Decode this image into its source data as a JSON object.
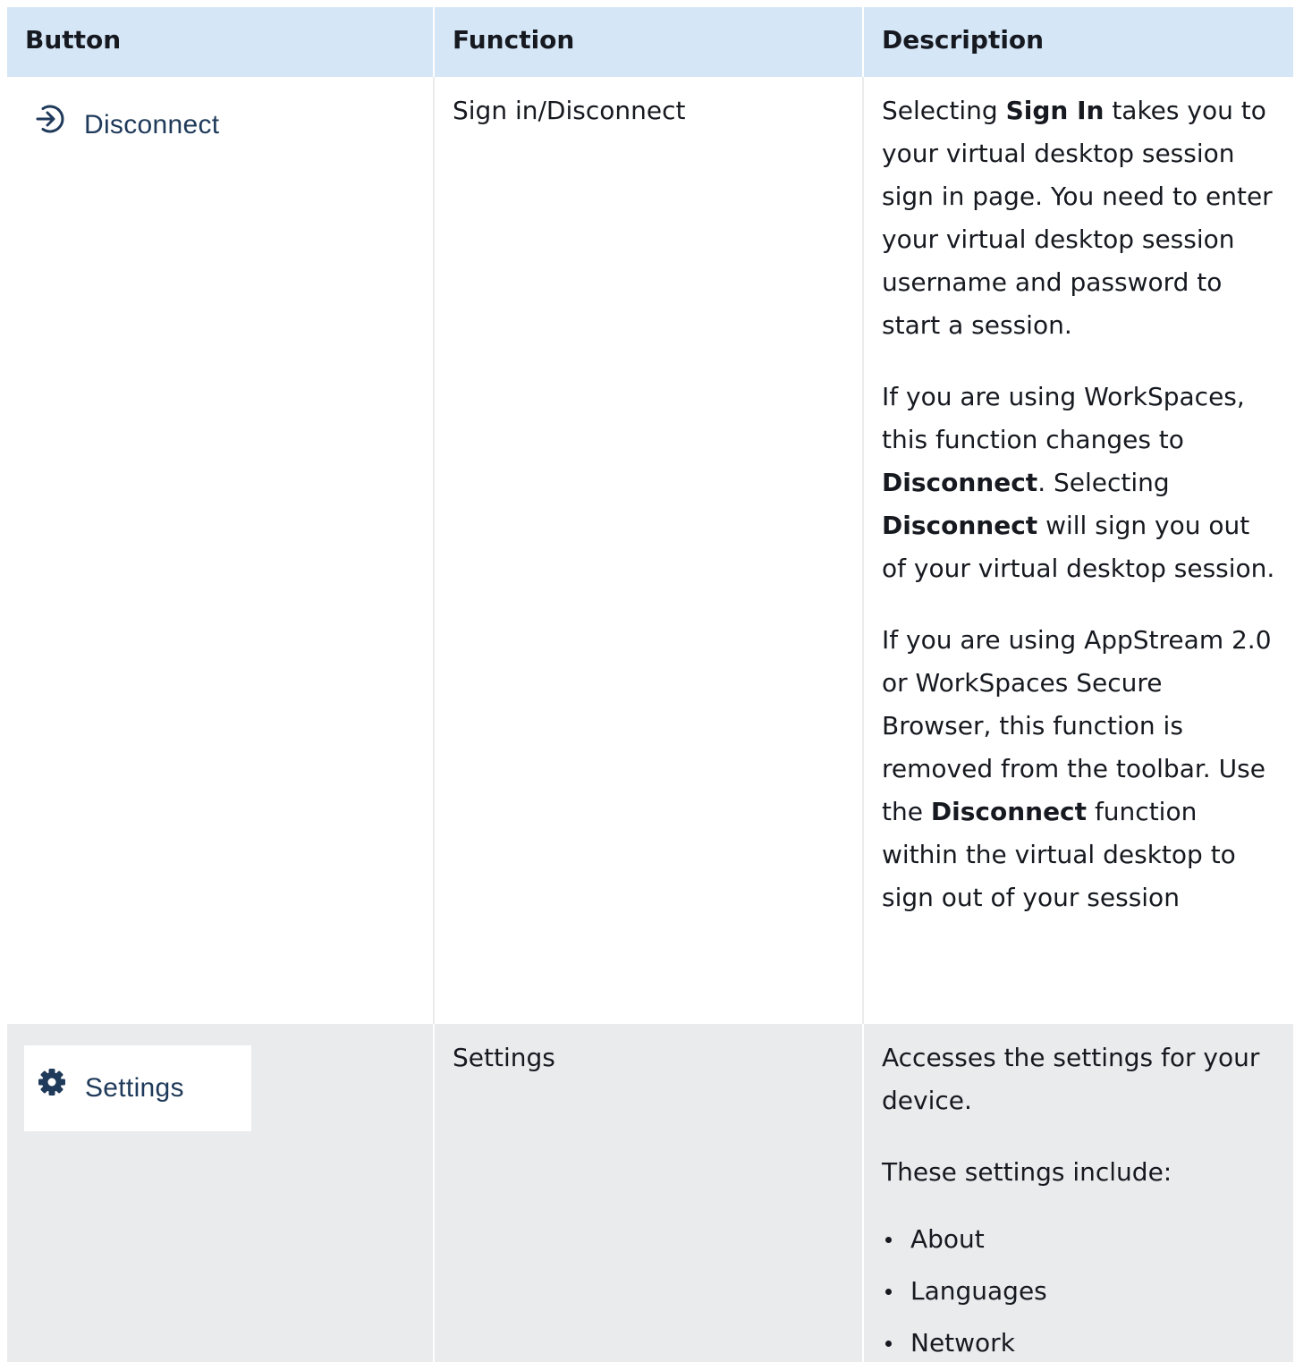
{
  "table": {
    "headers": [
      "Button",
      "Function",
      "Description"
    ],
    "rows": [
      {
        "button": {
          "label": "Disconnect",
          "icon": "sign-in-arrow-icon"
        },
        "function": "Sign in/Disconnect",
        "description": {
          "p1": {
            "a": "Selecting ",
            "b": "Sign In",
            "c": " takes you to your virtual desktop session sign in page. You need to enter your virtual desktop session username and password to start a session."
          },
          "p2": {
            "a": "If you are using WorkSpaces, this function changes to ",
            "b": "Disconnect",
            "c": ". Selecting ",
            "d": "Disconnect",
            "e": " will sign you out of your virtual desktop session."
          },
          "p3": {
            "a": "If you are using AppStream 2.0 or WorkSpaces Secure Browser, this function is removed from the toolbar. Use the ",
            "b": "Disconnect",
            "c": " function within the virtual desktop to sign out of your session"
          }
        }
      },
      {
        "button": {
          "label": "Settings",
          "icon": "gear-icon"
        },
        "function": "Settings",
        "description": {
          "p1": "Accesses the settings for your device.",
          "p2": "These settings include:",
          "items": [
            "About",
            "Languages",
            "Network"
          ]
        }
      }
    ]
  },
  "colors": {
    "header_bg": "#d5e6f7",
    "alt_row_bg": "#e9ebed",
    "button_text": "#1f3a5a"
  }
}
